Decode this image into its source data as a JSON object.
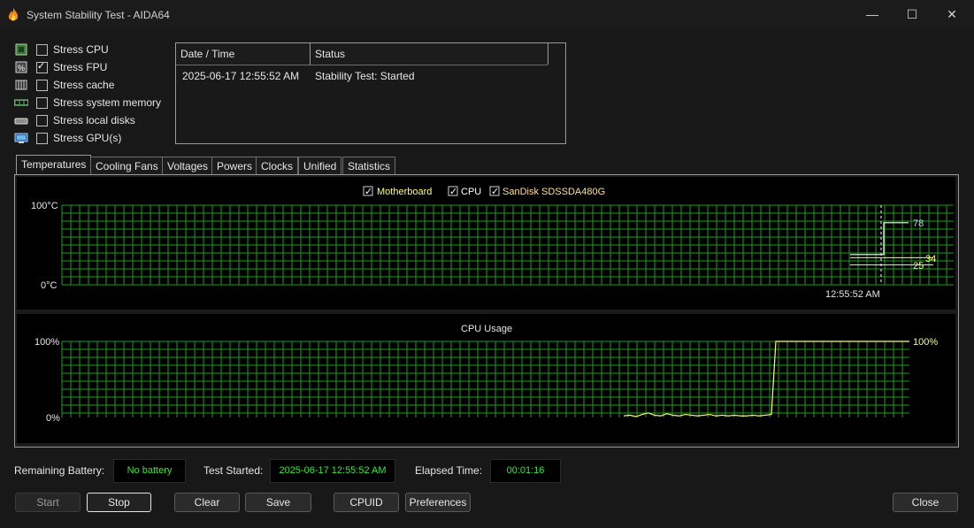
{
  "window": {
    "title": "System Stability Test - AIDA64",
    "minimize_glyph": "—",
    "maximize_glyph": "☐",
    "close_glyph": "✕"
  },
  "stress": [
    {
      "label": "Stress CPU",
      "checked": false,
      "icon": "cpu-icon"
    },
    {
      "label": "Stress FPU",
      "checked": true,
      "icon": "fpu-icon"
    },
    {
      "label": "Stress cache",
      "checked": false,
      "icon": "cache-icon"
    },
    {
      "label": "Stress system memory",
      "checked": false,
      "icon": "memory-icon"
    },
    {
      "label": "Stress local disks",
      "checked": false,
      "icon": "disk-icon"
    },
    {
      "label": "Stress GPU(s)",
      "checked": false,
      "icon": "gpu-icon"
    }
  ],
  "log": {
    "columns": [
      "Date / Time",
      "Status"
    ],
    "rows": [
      {
        "datetime": "2025-06-17 12:55:52 AM",
        "status": "Stability Test: Started"
      }
    ]
  },
  "tabs": [
    "Temperatures",
    "Cooling Fans",
    "Voltages",
    "Powers",
    "Clocks",
    "Unified",
    "Statistics"
  ],
  "active_tab": "Temperatures",
  "temp_chart": {
    "legend": [
      {
        "label": "Motherboard",
        "checked": true,
        "color": "#ffff66"
      },
      {
        "label": "CPU",
        "checked": true,
        "color": "#ffffff"
      },
      {
        "label": "SanDisk SDSSDA480G",
        "checked": true,
        "color": "#ffe08a"
      }
    ],
    "y_max_label": "100°C",
    "y_min_label": "0°C",
    "marker_time": "12:55:52 AM",
    "value_labels": [
      {
        "text": "78",
        "color": "#c8c8ff"
      },
      {
        "text": "34",
        "color": "#ffff66"
      },
      {
        "text": "25",
        "color": "#ffff66"
      }
    ]
  },
  "cpu_chart": {
    "title": "CPU Usage",
    "y_max_label": "100%",
    "y_min_label": "0%",
    "current_label": "100%"
  },
  "chart_data": [
    {
      "type": "line",
      "title": "",
      "ylim": [
        0,
        100
      ],
      "yunit": "°C",
      "series": [
        {
          "name": "Motherboard",
          "values": [
            34,
            34,
            34,
            34
          ]
        },
        {
          "name": "CPU",
          "values": [
            38,
            38,
            38,
            78,
            78
          ]
        },
        {
          "name": "SanDisk SDSSDA480G",
          "values": [
            25,
            25,
            25,
            25
          ]
        }
      ]
    },
    {
      "type": "line",
      "title": "CPU Usage",
      "ylim": [
        0,
        100
      ],
      "yunit": "%",
      "series": [
        {
          "values": [
            2,
            3,
            1,
            4,
            6,
            3,
            2,
            5,
            3,
            2,
            4,
            3,
            2,
            3,
            4,
            2,
            3,
            2,
            3,
            2,
            2,
            3,
            2,
            3,
            4,
            100,
            100,
            100,
            100,
            100,
            100,
            100,
            100
          ]
        }
      ]
    }
  ],
  "status": {
    "battery_label": "Remaining Battery:",
    "battery_value": "No battery",
    "started_label": "Test Started:",
    "started_value": "2025-06-17 12:55:52 AM",
    "elapsed_label": "Elapsed Time:",
    "elapsed_value": "00:01:16"
  },
  "buttons": {
    "start": "Start",
    "stop": "Stop",
    "clear": "Clear",
    "save": "Save",
    "cpuid": "CPUID",
    "preferences": "Preferences",
    "close": "Close"
  },
  "colors": {
    "grid": "#1a9e1a",
    "cpu_line": "#ffff66",
    "temp_cpu_line": "#ffffff",
    "status_text": "#39e639"
  }
}
